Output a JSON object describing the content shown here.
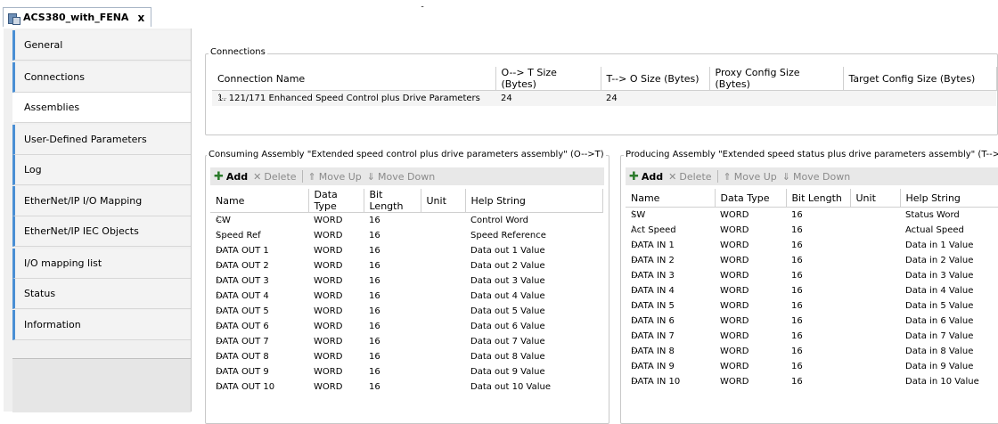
{
  "top_strip_text": ", ",
  "editor_tab": {
    "label": "ACS380_with_FENA",
    "close": "x"
  },
  "nav": {
    "items": [
      {
        "label": "General"
      },
      {
        "label": "Connections"
      },
      {
        "label": "Assemblies"
      },
      {
        "label": "User-Defined Parameters"
      },
      {
        "label": "Log"
      },
      {
        "label": "EtherNet/IP I/O Mapping"
      },
      {
        "label": "EtherNet/IP IEC Objects"
      },
      {
        "label": "I/O mapping list"
      },
      {
        "label": "Status"
      },
      {
        "label": "Information"
      }
    ],
    "active": "Assemblies"
  },
  "connections": {
    "title": "Connections",
    "columns": [
      "Connection Name",
      "O--> T Size (Bytes)",
      "T--> O Size (Bytes)",
      "Proxy Config Size (Bytes)",
      "Target Config Size (Bytes)"
    ],
    "rows": [
      {
        "name": "1. 121/171 Enhanced Speed Control plus Drive Parameters",
        "ot": "24",
        "to": "24",
        "proxy": "",
        "target": ""
      }
    ]
  },
  "consuming": {
    "title": "Consuming Assembly \"Extended speed control plus drive parameters assembly\" (O-->T)",
    "toolbar": {
      "add": "Add",
      "delete": "Delete",
      "move_up": "Move Up",
      "move_down": "Move Down"
    },
    "columns": [
      "Name",
      "Data Type",
      "Bit Length",
      "Unit",
      "Help String"
    ],
    "rows": [
      {
        "name": "CW",
        "type": "WORD",
        "bits": "16",
        "unit": "",
        "help": "Control Word"
      },
      {
        "name": "Speed Ref",
        "type": "WORD",
        "bits": "16",
        "unit": "",
        "help": "Speed Reference"
      },
      {
        "name": "DATA OUT 1",
        "type": "WORD",
        "bits": "16",
        "unit": "",
        "help": "Data out 1 Value"
      },
      {
        "name": "DATA OUT 2",
        "type": "WORD",
        "bits": "16",
        "unit": "",
        "help": "Data out 2 Value"
      },
      {
        "name": "DATA OUT 3",
        "type": "WORD",
        "bits": "16",
        "unit": "",
        "help": "Data out 3 Value"
      },
      {
        "name": "DATA OUT 4",
        "type": "WORD",
        "bits": "16",
        "unit": "",
        "help": "Data out 4 Value"
      },
      {
        "name": "DATA OUT 5",
        "type": "WORD",
        "bits": "16",
        "unit": "",
        "help": "Data out 5 Value"
      },
      {
        "name": "DATA OUT 6",
        "type": "WORD",
        "bits": "16",
        "unit": "",
        "help": "Data out 6 Value"
      },
      {
        "name": "DATA OUT 7",
        "type": "WORD",
        "bits": "16",
        "unit": "",
        "help": "Data out 7 Value"
      },
      {
        "name": "DATA OUT 8",
        "type": "WORD",
        "bits": "16",
        "unit": "",
        "help": "Data out 8 Value"
      },
      {
        "name": "DATA OUT 9",
        "type": "WORD",
        "bits": "16",
        "unit": "",
        "help": "Data out 9 Value"
      },
      {
        "name": "DATA OUT 10",
        "type": "WORD",
        "bits": "16",
        "unit": "",
        "help": "Data out 10 Value"
      }
    ]
  },
  "producing": {
    "title": "Producing Assembly \"Extended speed status plus drive parameters assembly\" (T-->O)",
    "toolbar": {
      "add": "Add",
      "delete": "Delete",
      "move_up": "Move Up",
      "move_down": "Move Down"
    },
    "columns": [
      "Name",
      "Data Type",
      "Bit Length",
      "Unit",
      "Help String"
    ],
    "rows": [
      {
        "name": "SW",
        "type": "WORD",
        "bits": "16",
        "unit": "",
        "help": "Status Word"
      },
      {
        "name": "Act Speed",
        "type": "WORD",
        "bits": "16",
        "unit": "",
        "help": "Actual Speed"
      },
      {
        "name": "DATA IN 1",
        "type": "WORD",
        "bits": "16",
        "unit": "",
        "help": "Data in 1 Value"
      },
      {
        "name": "DATA IN 2",
        "type": "WORD",
        "bits": "16",
        "unit": "",
        "help": "Data in 2 Value"
      },
      {
        "name": "DATA IN 3",
        "type": "WORD",
        "bits": "16",
        "unit": "",
        "help": "Data in 3 Value"
      },
      {
        "name": "DATA IN 4",
        "type": "WORD",
        "bits": "16",
        "unit": "",
        "help": "Data in 4 Value"
      },
      {
        "name": "DATA IN 5",
        "type": "WORD",
        "bits": "16",
        "unit": "",
        "help": "Data in 5 Value"
      },
      {
        "name": "DATA IN 6",
        "type": "WORD",
        "bits": "16",
        "unit": "",
        "help": "Data in 6 Value"
      },
      {
        "name": "DATA IN 7",
        "type": "WORD",
        "bits": "16",
        "unit": "",
        "help": "Data in 7 Value"
      },
      {
        "name": "DATA IN 8",
        "type": "WORD",
        "bits": "16",
        "unit": "",
        "help": "Data in 8 Value"
      },
      {
        "name": "DATA IN 9",
        "type": "WORD",
        "bits": "16",
        "unit": "",
        "help": "Data in 9 Value"
      },
      {
        "name": "DATA IN 10",
        "type": "WORD",
        "bits": "16",
        "unit": "",
        "help": "Data in 10 Value"
      }
    ]
  }
}
